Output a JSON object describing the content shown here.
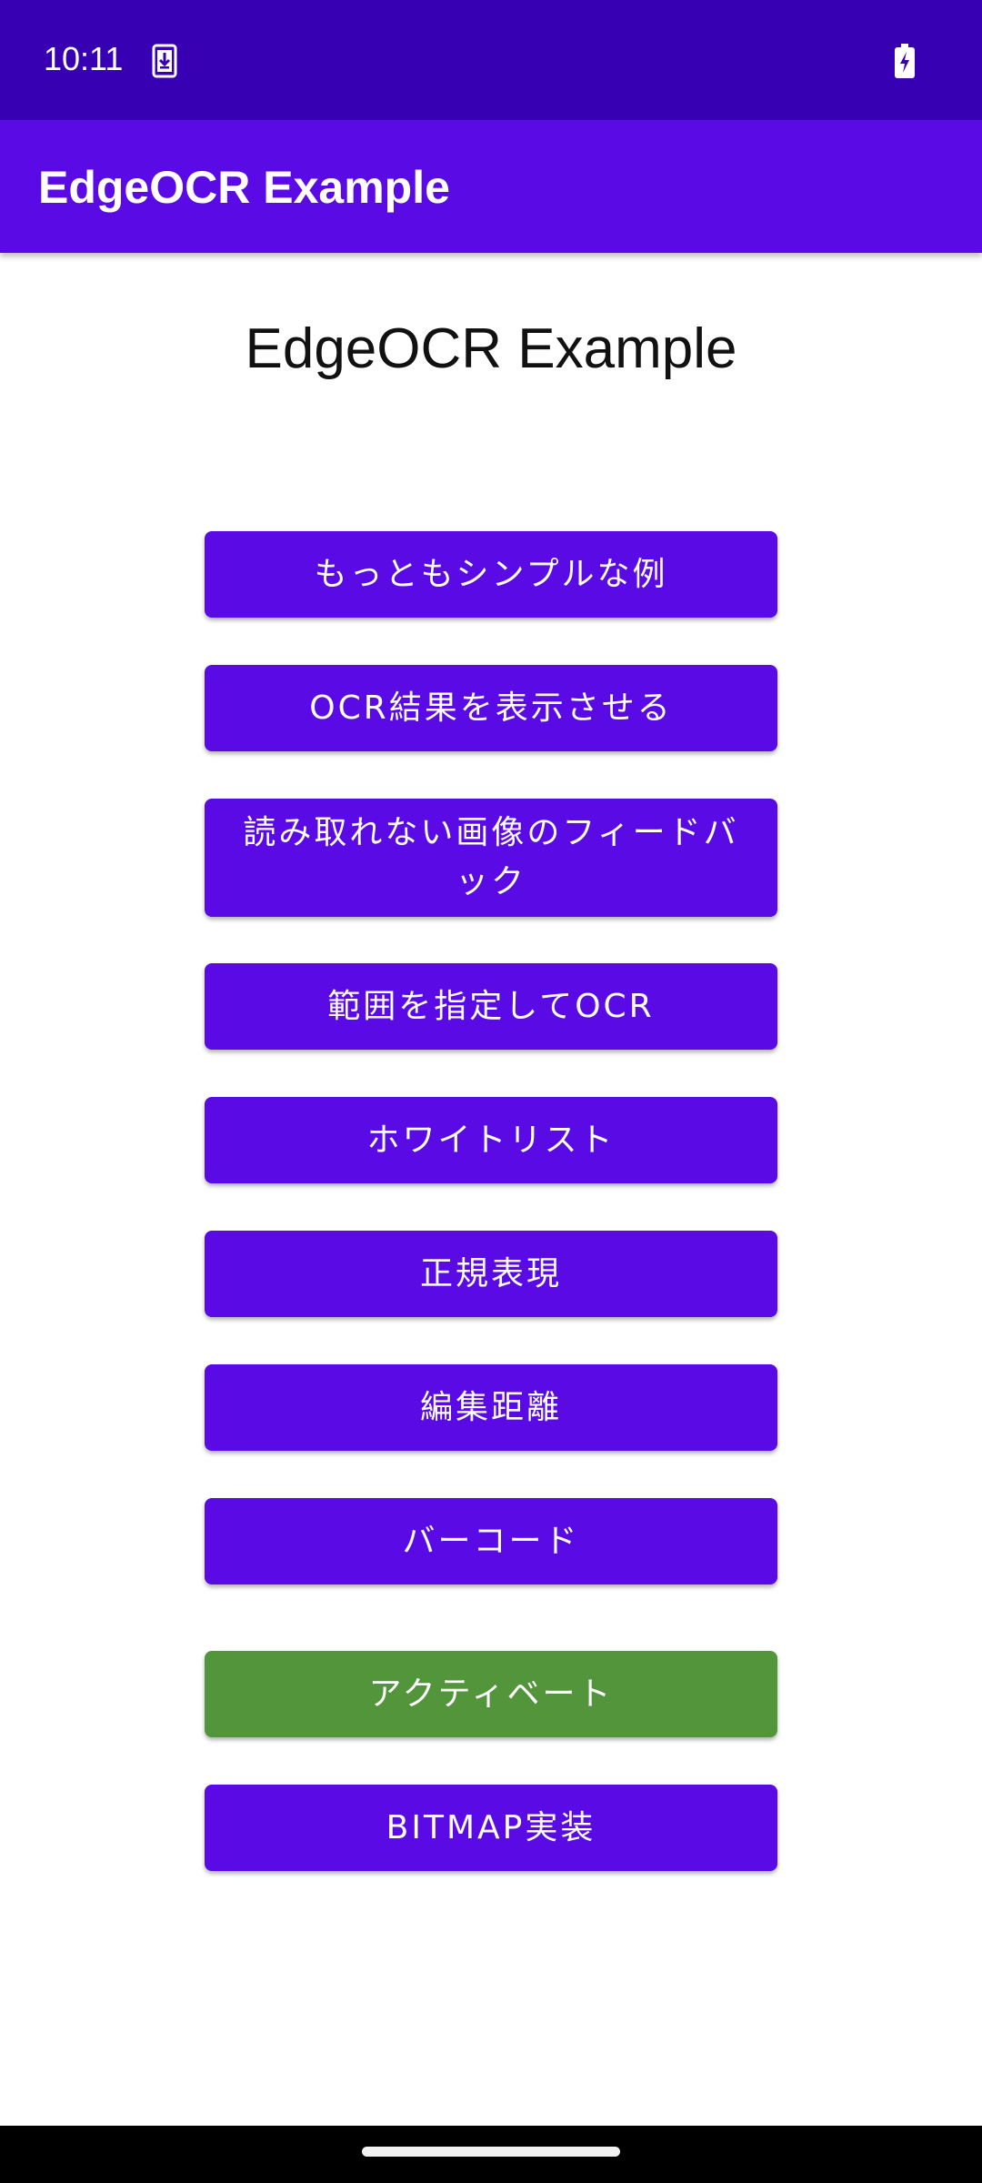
{
  "status_bar": {
    "time": "10:11",
    "icons": [
      "download-icon",
      "battery-charging-icon"
    ],
    "background": "#3700b3"
  },
  "app_bar": {
    "title": "EdgeOCR Example",
    "background": "#5a0be5"
  },
  "main": {
    "heading": "EdgeOCR Example",
    "buttons": [
      {
        "label": "もっともシンプルな例",
        "color": "#5a0be5"
      },
      {
        "label": "OCR結果を表示させる",
        "color": "#5a0be5"
      },
      {
        "label": "読み取れない画像のフィードバック",
        "color": "#5a0be5"
      },
      {
        "label": "範囲を指定してOCR",
        "color": "#5a0be5"
      },
      {
        "label": "ホワイトリスト",
        "color": "#5a0be5"
      },
      {
        "label": "正規表現",
        "color": "#5a0be5"
      },
      {
        "label": "編集距離",
        "color": "#5a0be5"
      },
      {
        "label": "バーコード",
        "color": "#5a0be5"
      },
      {
        "label": "アクティベート",
        "color": "#53953b"
      },
      {
        "label": "BITMAP実装",
        "color": "#5a0be5"
      }
    ]
  },
  "nav_bar": {
    "handle": "home-gesture-handle"
  }
}
